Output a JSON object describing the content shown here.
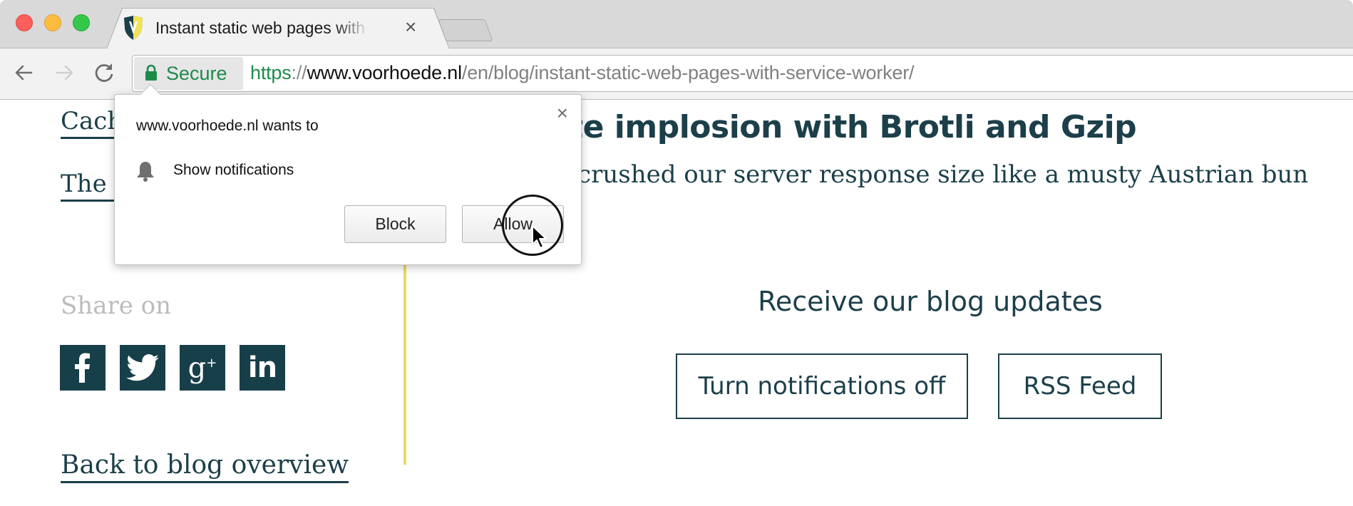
{
  "browser": {
    "tab": {
      "title": "Instant static web pages with Service Worker",
      "favicon": "voorhoede-shield-icon"
    },
    "toolbar": {
      "back_icon": "arrow-left-icon",
      "forward_icon": "arrow-right-icon",
      "reload_icon": "reload-icon"
    },
    "omnibox": {
      "security_label": "Secure",
      "url_scheme": "https",
      "url_separator": "://",
      "url_host": "www.voorhoede.nl",
      "url_path": "/en/blog/instant-static-web-pages-with-service-worker/"
    }
  },
  "permission_prompt": {
    "origin_text": "www.voorhoede.nl wants to",
    "permission_icon": "bell-icon",
    "permission_text": "Show notifications",
    "block_label": "Block",
    "allow_label": "Allow",
    "close_label": "×"
  },
  "sidebar": {
    "related_links": [
      {
        "label": "Caching beyond the cache"
      },
      {
        "label": "The Voorhoede website"
      }
    ],
    "share_label": "Share on",
    "share_icons": [
      {
        "name": "facebook",
        "glyph": "f"
      },
      {
        "name": "twitter",
        "glyph": ""
      },
      {
        "name": "google-plus",
        "glyph": "g+"
      },
      {
        "name": "linkedin",
        "glyph": "in"
      }
    ],
    "back_link": "Back to blog overview"
  },
  "article_teaser": {
    "title": "Website implosion with Brotli and Gzip",
    "subtitle": "How we crushed our server response size like a musty Austrian bun"
  },
  "subscribe": {
    "heading": "Receive our blog updates",
    "notifications_button": "Turn notifications off",
    "rss_button": "RSS Feed"
  },
  "colors": {
    "brand_teal": "#1c3f4a",
    "accent_yellow": "#e9dc5a",
    "secure_green": "#1e8a4c"
  }
}
